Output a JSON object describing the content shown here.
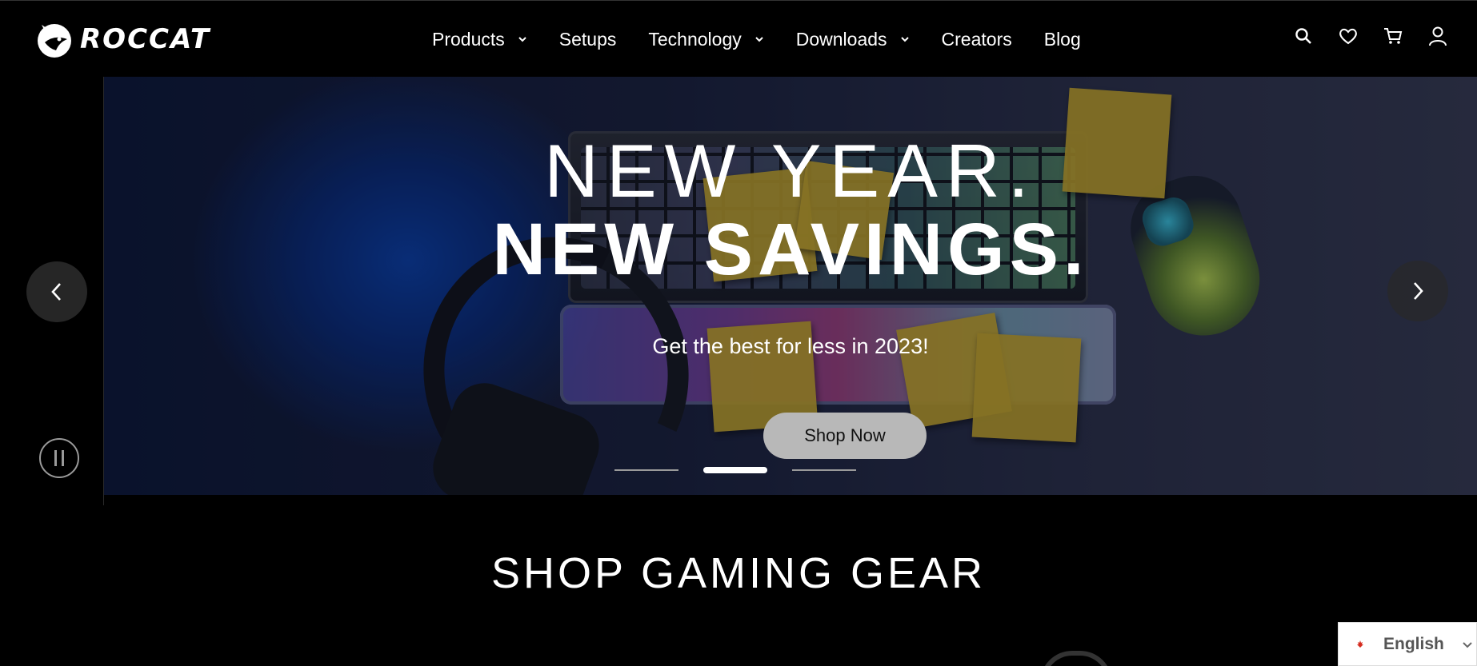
{
  "brand": {
    "logo_text": "ROCCAT",
    "logo_mark": "roccat-panther-logo"
  },
  "nav": {
    "items": [
      {
        "label": "Products",
        "has_dropdown": true
      },
      {
        "label": "Setups",
        "has_dropdown": false
      },
      {
        "label": "Technology",
        "has_dropdown": true
      },
      {
        "label": "Downloads",
        "has_dropdown": true
      },
      {
        "label": "Creators",
        "has_dropdown": false
      },
      {
        "label": "Blog",
        "has_dropdown": false
      }
    ]
  },
  "header_icons": [
    "search-icon",
    "wishlist-heart-icon",
    "cart-icon",
    "account-icon"
  ],
  "hero": {
    "headline_line1": "NEW YEAR.",
    "headline_line2": "NEW SAVINGS.",
    "subheadline": "Get the best for less in 2023!",
    "cta_label": "Shop Now",
    "slides_count": 3,
    "active_slide": 2
  },
  "carousel_controls": {
    "prev_icon": "chevron-left-icon",
    "next_icon": "chevron-right-icon",
    "pause_icon": "pause-icon"
  },
  "section": {
    "title": "SHOP GAMING GEAR"
  },
  "language": {
    "label": "English",
    "flag": "canada-flag-icon"
  },
  "colors": {
    "background": "#000000",
    "cta_bg": "#b8b8b8",
    "accent_white": "#ffffff"
  }
}
